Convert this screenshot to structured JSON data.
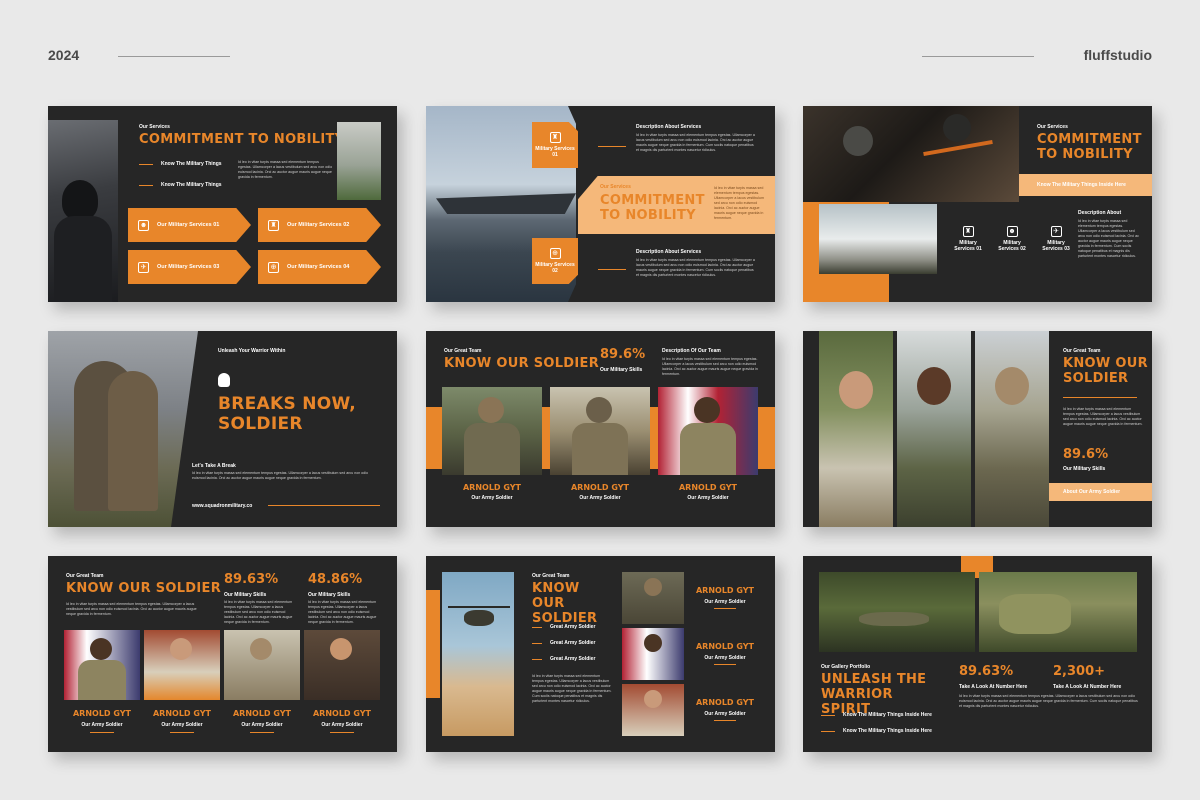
{
  "header": {
    "year": "2024",
    "brand": "fluffstudio"
  },
  "lorem": "Id leo in vitae turpis massa sed elementum tempus egestas. Ullamcorper a lacus vestibulum sed arcu non odio euismod lacinia. Orci ac auctor augue mauris augue neque gravida in fermentum. Cum sociis natoque penatibus et magnis dis parturient montes nascetur ridiculus.",
  "lorem_short": "Id leo in vitae turpis massa sed elementum tempus egestas. Ullamcorper a lacus vestibulum sed arcu non odio euismod lacinia. Orci ac auctor augue mauris augue neque gravida in fermentum.",
  "s1": {
    "kicker": "Our Services",
    "title": "COMMITMENT TO NOBILITY",
    "bullets": [
      "Know The Military Things",
      "Know The Military Things"
    ],
    "services": [
      "Our Military Services 01",
      "Our Military Services 02",
      "Our Military Services 03",
      "Our Military Services 04"
    ]
  },
  "s2": {
    "svc1": "Military Services 01",
    "svc2": "Military Services 02",
    "kicker": "Our Services",
    "title": "COMMITMENT TO NOBILITY",
    "desc1": "Description About Services",
    "desc2": "Description About Services"
  },
  "s3": {
    "kicker": "Our Services",
    "title": "COMMITMENT TO NOBILITY",
    "band": "Know The Military Things Inside Here",
    "desc": "Description About",
    "services": [
      "Military Services 01",
      "Military Services 02",
      "Military Services 03"
    ]
  },
  "s4": {
    "kicker": "Unleash Your Warrior Within",
    "title": "BREAKS NOW, SOLDIER",
    "sub": "Let's Take A Break",
    "url": "www.squadronmilitary.co"
  },
  "s5": {
    "kicker": "Our Great Team",
    "title": "KNOW OUR SOLDIER",
    "stat": "89.6%",
    "stat_label": "Our Military Skills",
    "desc": "Description Of Our Team",
    "members": [
      {
        "name": "ARNOLD GYT",
        "role": "Our Army Soldier"
      },
      {
        "name": "ARNOLD GYT",
        "role": "Our Army Soldier"
      },
      {
        "name": "ARNOLD GYT",
        "role": "Our Army Soldier"
      }
    ]
  },
  "s6": {
    "kicker": "Our Great Team",
    "title": "KNOW OUR SOLDIER",
    "stat": "89.6%",
    "stat_label": "Our Military Skills",
    "band": "About Our Army Soldier"
  },
  "s7": {
    "kicker": "Our Great Team",
    "title": "KNOW OUR SOLDIER",
    "stat1": "89.63%",
    "stat1_label": "Our Military Skills",
    "stat2": "48.86%",
    "stat2_label": "Our Military Skills",
    "members": [
      {
        "name": "ARNOLD GYT",
        "role": "Our Army Soldier"
      },
      {
        "name": "ARNOLD GYT",
        "role": "Our Army Soldier"
      },
      {
        "name": "ARNOLD GYT",
        "role": "Our Army Soldier"
      },
      {
        "name": "ARNOLD GYT",
        "role": "Our Army Soldier"
      }
    ]
  },
  "s8": {
    "kicker": "Our Great Team",
    "title": "KNOW OUR SOLDIER",
    "list": [
      "Great Army Soldier",
      "Great Army Soldier",
      "Great Army Soldier"
    ],
    "members": [
      {
        "name": "ARNOLD GYT",
        "role": "Our Army Soldier"
      },
      {
        "name": "ARNOLD GYT",
        "role": "Our Army Soldier"
      },
      {
        "name": "ARNOLD GYT",
        "role": "Our Army Soldier"
      }
    ]
  },
  "s9": {
    "kicker": "Our Gallery Portfolio",
    "title": "UNLEASH THE WARRIOR SPIRIT",
    "stat1": "89.63%",
    "stat1_label": "Take A Look At Number Here",
    "stat2": "2,300+",
    "stat2_label": "Take A Look At Number Here",
    "bullets": [
      "Know The Military Things Inside Here",
      "Know The Military Things Inside Here"
    ]
  }
}
